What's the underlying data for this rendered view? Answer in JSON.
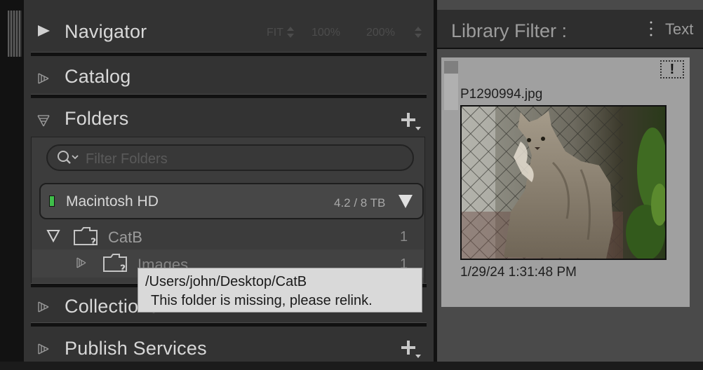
{
  "left_panel": {
    "navigator": {
      "title": "Navigator",
      "zoom_options": [
        "FIT",
        "100%",
        "200%"
      ]
    },
    "catalog": {
      "title": "Catalog"
    },
    "folders": {
      "title": "Folders",
      "filter_placeholder": "Filter Folders",
      "volume": {
        "name": "Macintosh HD",
        "usage": "4.2 / 8 TB",
        "indicator_color": "#3fbe4a"
      },
      "items": [
        {
          "name": "CatB",
          "count": "1",
          "expanded": true,
          "missing": true
        },
        {
          "name": "Images",
          "count": "1",
          "expanded": false,
          "missing": true
        }
      ]
    },
    "collections": {
      "title": "Collections"
    },
    "publish_services": {
      "title": "Publish Services"
    }
  },
  "tooltip": {
    "path": "/Users/john/Desktop/CatB",
    "message": " This folder is missing, please relink."
  },
  "library_filter": {
    "title": "Library Filter :",
    "mode": "Text"
  },
  "grid": {
    "cell": {
      "filename": "P1290994.jpg",
      "timestamp": "1/29/24 1:31:48 PM",
      "badge": "!"
    }
  },
  "colors": {
    "panel_bg": "#333333",
    "tooltip_bg": "#d9d9d9",
    "cell_bg": "#a0a0a0"
  }
}
